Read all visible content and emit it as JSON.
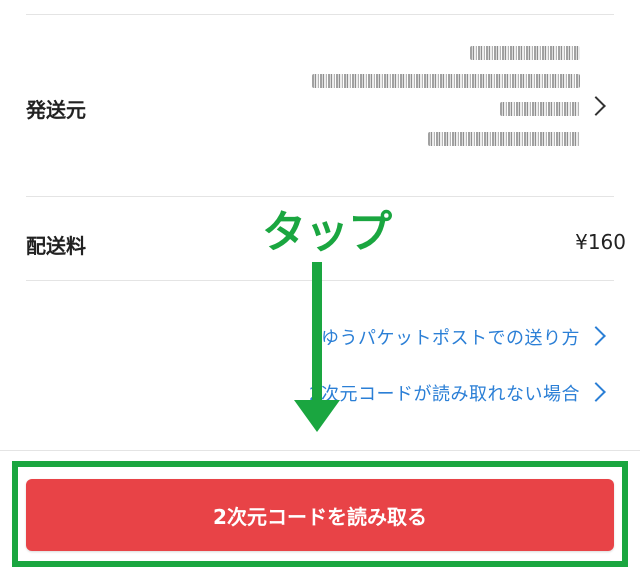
{
  "shipping_details": {
    "sender_label": "発送元",
    "fee_label": "配送料",
    "fee_value": "¥160"
  },
  "help_links": [
    {
      "label": "ゆうパケットポストでの送り方"
    },
    {
      "label": "2次元コードが読み取れない場合"
    }
  ],
  "annotation": {
    "text": "タップ"
  },
  "action": {
    "scan_label": "2次元コードを読み取る"
  },
  "colors": {
    "primary_button": "#e84347",
    "link": "#2b7fd6",
    "annotation": "#1aa640"
  },
  "icons": [
    "chevron-right-icon",
    "arrow-down-icon"
  ]
}
